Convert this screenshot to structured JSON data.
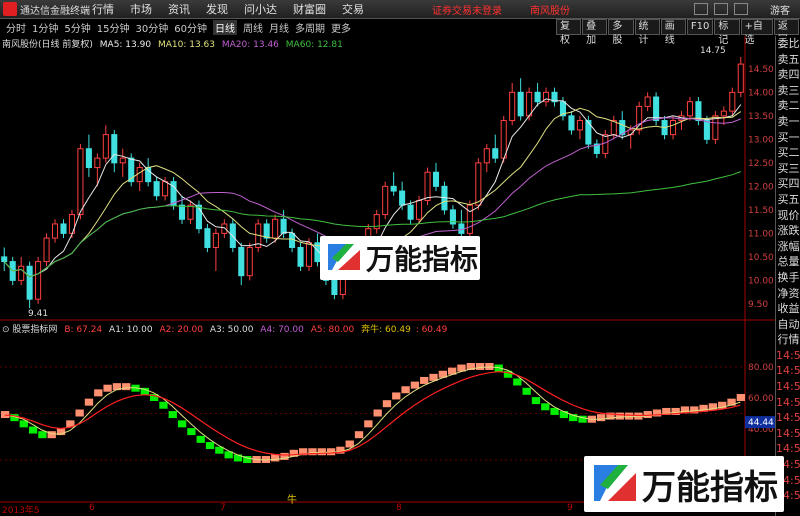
{
  "topbar": {
    "app_name": "通达信金融终端",
    "menu": [
      "行情",
      "市场",
      "资讯",
      "发现",
      "问小达",
      "财富圈",
      "交易"
    ],
    "notice": "证券交易未登录",
    "stock_name": "南风股份",
    "guest": "游客"
  },
  "periods": [
    "分时",
    "1分钟",
    "5分钟",
    "15分钟",
    "30分钟",
    "60分钟",
    "日线",
    "周线",
    "月线",
    "多周期",
    "更多"
  ],
  "active_period": "日线",
  "toolbar": [
    "复权",
    "叠加",
    "多股",
    "统计",
    "画线",
    "F10",
    "标记",
    "+自选",
    "返回"
  ],
  "main_legend": {
    "title": "南风股份(日线 前复权)",
    "ma5": "MA5: 13.90",
    "ma10": "MA10: 13.63",
    "ma20": "MA20: 13.46",
    "ma60": "MA60: 12.81"
  },
  "indicator_legend": {
    "title": "股票指标网",
    "b": "B: 67.24",
    "a1": "A1: 10.00",
    "a2": "A2: 20.00",
    "a3": "A3: 50.00",
    "a4": "A4: 70.00",
    "a5": "A5: 80.00",
    "bull": "奔牛: 60.49",
    "last": ": 60.49"
  },
  "price_axis": [
    "14.50",
    "14.00",
    "13.50",
    "13.00",
    "12.50",
    "12.00",
    "11.50",
    "11.00",
    "10.50",
    "10.00",
    "9.50"
  ],
  "indicator_axis": [
    "80.00",
    "60.00",
    "40.00",
    "20.00"
  ],
  "price_marks": {
    "high": "14.75",
    "low": "9.41"
  },
  "indicator_badge": "44.44",
  "right_panel": {
    "items": [
      "委比",
      "卖五",
      "卖四",
      "卖三",
      "卖二",
      "卖一",
      "买一",
      "买二",
      "买三",
      "买四",
      "买五",
      "现价",
      "涨跌",
      "涨幅",
      "总量",
      "换手",
      "净资",
      "收益",
      "自动",
      "行情",
      "14:56",
      "14:56",
      "14:56",
      "14:56",
      "14:56",
      "14:56",
      "14:56",
      "14:56",
      "14:56",
      "14:56"
    ]
  },
  "dates": {
    "year": "2013年5",
    "m6": "6",
    "m7": "7",
    "m8": "8",
    "m9": "9"
  },
  "bull_label": "牛",
  "watermark": "万能指标",
  "colors": {
    "up": "#ff4040",
    "down": "#40e0e0",
    "ma5": "#e8e8e8",
    "ma10": "#e0e080",
    "ma20": "#c060d0",
    "ma60": "#40c040",
    "ind_green": "#00ee00",
    "ind_salmon": "#ff9070",
    "ind_red": "#ff2020",
    "ind_yellow": "#e0e080"
  },
  "chart_data": [
    {
      "type": "candlestick",
      "title": "南风股份(日线 前复权)",
      "ylim": [
        9.2,
        14.9
      ],
      "ohlc": [
        [
          10.5,
          10.7,
          10.2,
          10.4
        ],
        [
          10.4,
          10.5,
          9.9,
          10.0
        ],
        [
          10.0,
          10.5,
          9.9,
          10.3
        ],
        [
          10.3,
          10.4,
          9.41,
          9.6
        ],
        [
          9.6,
          10.5,
          9.5,
          10.4
        ],
        [
          10.4,
          11.0,
          10.3,
          10.9
        ],
        [
          10.9,
          11.3,
          10.8,
          11.2
        ],
        [
          11.2,
          11.3,
          10.9,
          11.0
        ],
        [
          11.0,
          11.5,
          10.9,
          11.4
        ],
        [
          11.4,
          12.9,
          11.3,
          12.8
        ],
        [
          12.8,
          13.1,
          12.2,
          12.4
        ],
        [
          12.4,
          12.7,
          12.0,
          12.6
        ],
        [
          12.6,
          13.3,
          12.5,
          13.1
        ],
        [
          13.1,
          13.2,
          12.3,
          12.5
        ],
        [
          12.5,
          12.8,
          12.2,
          12.6
        ],
        [
          12.6,
          12.7,
          12.0,
          12.1
        ],
        [
          12.1,
          12.5,
          11.9,
          12.4
        ],
        [
          12.4,
          12.6,
          12.0,
          12.1
        ],
        [
          12.1,
          12.2,
          11.7,
          11.8
        ],
        [
          11.8,
          12.2,
          11.7,
          12.1
        ],
        [
          12.1,
          12.2,
          11.5,
          11.6
        ],
        [
          11.6,
          11.8,
          11.2,
          11.3
        ],
        [
          11.3,
          11.7,
          11.2,
          11.6
        ],
        [
          11.6,
          11.7,
          11.0,
          11.1
        ],
        [
          11.1,
          11.2,
          10.6,
          10.7
        ],
        [
          10.7,
          11.1,
          10.2,
          11.0
        ],
        [
          11.0,
          11.3,
          10.9,
          11.2
        ],
        [
          11.2,
          11.3,
          10.6,
          10.7
        ],
        [
          10.7,
          10.8,
          9.9,
          10.1
        ],
        [
          10.1,
          10.8,
          10.0,
          10.7
        ],
        [
          10.7,
          11.3,
          10.6,
          11.2
        ],
        [
          11.2,
          11.3,
          10.8,
          10.9
        ],
        [
          10.9,
          11.4,
          10.8,
          11.3
        ],
        [
          11.3,
          11.5,
          10.9,
          11.0
        ],
        [
          11.0,
          11.1,
          10.6,
          10.7
        ],
        [
          10.7,
          10.8,
          10.2,
          10.3
        ],
        [
          10.3,
          10.9,
          10.2,
          10.8
        ],
        [
          10.8,
          11.0,
          10.3,
          10.4
        ],
        [
          10.4,
          10.6,
          9.9,
          10.0
        ],
        [
          10.0,
          10.2,
          9.6,
          9.7
        ],
        [
          9.7,
          10.3,
          9.6,
          10.2
        ],
        [
          10.2,
          10.6,
          10.1,
          10.5
        ],
        [
          10.5,
          10.7,
          10.4,
          10.6
        ],
        [
          10.6,
          11.2,
          10.5,
          11.1
        ],
        [
          11.1,
          11.5,
          11.0,
          11.4
        ],
        [
          11.4,
          12.1,
          11.3,
          12.0
        ],
        [
          12.0,
          12.3,
          11.8,
          11.9
        ],
        [
          11.9,
          12.1,
          11.5,
          11.6
        ],
        [
          11.6,
          11.7,
          11.2,
          11.3
        ],
        [
          11.3,
          11.8,
          11.2,
          11.7
        ],
        [
          11.7,
          12.4,
          11.6,
          12.3
        ],
        [
          12.3,
          12.5,
          11.9,
          12.0
        ],
        [
          12.0,
          12.1,
          11.4,
          11.5
        ],
        [
          11.5,
          11.6,
          11.1,
          11.2
        ],
        [
          11.2,
          11.5,
          10.9,
          11.0
        ],
        [
          11.0,
          11.7,
          10.9,
          11.6
        ],
        [
          11.6,
          12.6,
          11.5,
          12.5
        ],
        [
          12.5,
          12.9,
          12.3,
          12.8
        ],
        [
          12.8,
          13.1,
          12.5,
          12.6
        ],
        [
          12.6,
          13.5,
          12.5,
          13.4
        ],
        [
          13.4,
          14.2,
          13.3,
          14.0
        ],
        [
          14.0,
          14.3,
          13.4,
          13.5
        ],
        [
          13.5,
          14.1,
          13.4,
          14.0
        ],
        [
          14.0,
          14.2,
          13.7,
          13.8
        ],
        [
          13.8,
          14.1,
          13.7,
          14.0
        ],
        [
          14.0,
          14.1,
          13.7,
          13.8
        ],
        [
          13.8,
          13.9,
          13.4,
          13.5
        ],
        [
          13.5,
          13.6,
          13.1,
          13.2
        ],
        [
          13.2,
          13.5,
          13.0,
          13.4
        ],
        [
          13.4,
          13.5,
          12.8,
          12.9
        ],
        [
          12.9,
          13.0,
          12.6,
          12.7
        ],
        [
          12.7,
          13.2,
          12.6,
          13.1
        ],
        [
          13.1,
          13.5,
          13.0,
          13.4
        ],
        [
          13.4,
          13.6,
          13.0,
          13.1
        ],
        [
          13.1,
          13.3,
          12.8,
          13.2
        ],
        [
          13.2,
          13.8,
          13.1,
          13.7
        ],
        [
          13.7,
          14.0,
          13.6,
          13.9
        ],
        [
          13.9,
          14.0,
          13.3,
          13.4
        ],
        [
          13.4,
          13.5,
          13.0,
          13.1
        ],
        [
          13.1,
          13.5,
          13.0,
          13.4
        ],
        [
          13.4,
          13.6,
          13.2,
          13.5
        ],
        [
          13.5,
          13.9,
          13.4,
          13.8
        ],
        [
          13.8,
          13.9,
          13.3,
          13.4
        ],
        [
          13.4,
          13.5,
          12.9,
          13.0
        ],
        [
          13.0,
          13.6,
          12.9,
          13.5
        ],
        [
          13.5,
          13.7,
          13.3,
          13.6
        ],
        [
          13.6,
          14.1,
          13.5,
          14.0
        ],
        [
          14.0,
          14.75,
          13.9,
          14.6
        ]
      ],
      "annotations": [
        "14.75",
        "9.41"
      ]
    },
    {
      "type": "line",
      "title": "股票指标网",
      "ylim": [
        0,
        100
      ],
      "series": [
        {
          "name": "奔牛",
          "values": [
            49,
            47,
            43,
            39,
            36,
            36,
            38,
            43,
            50,
            57,
            63,
            66,
            67,
            67,
            66,
            64,
            60,
            55,
            49,
            43,
            38,
            33,
            29,
            26,
            23,
            21,
            20,
            20,
            20,
            21,
            22,
            24,
            25,
            25,
            25,
            25,
            26,
            30,
            36,
            43,
            50,
            56,
            61,
            65,
            68,
            71,
            73,
            75,
            77,
            79,
            80,
            80,
            80,
            79,
            75,
            70,
            64,
            58,
            54,
            51,
            49,
            47,
            46,
            46,
            47,
            48,
            48,
            48,
            48,
            49,
            50,
            51,
            51,
            52,
            52,
            53,
            54,
            55,
            57,
            60
          ]
        }
      ]
    }
  ]
}
